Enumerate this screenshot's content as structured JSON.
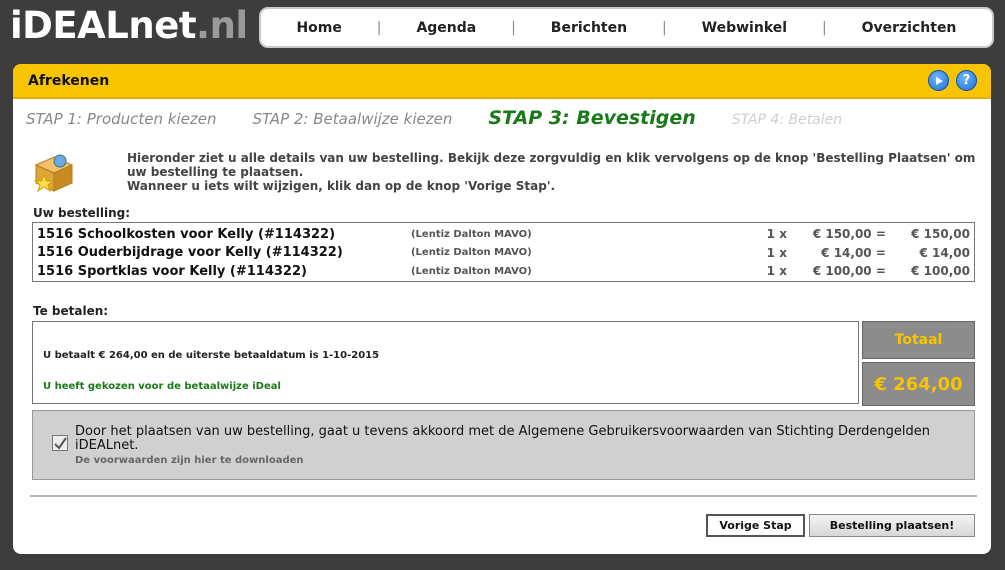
{
  "brand": {
    "name_main": "iDEALnet",
    "name_suffix": ".nl"
  },
  "nav": {
    "items": [
      "Home",
      "Agenda",
      "Berichten",
      "Webwinkel",
      "Overzichten"
    ],
    "separator": "|"
  },
  "panel": {
    "title": "Afrekenen",
    "next_icon": "play-icon",
    "help_icon": "help-icon"
  },
  "steps": [
    {
      "label": "STAP 1: Producten kiezen",
      "state": "done"
    },
    {
      "label": "STAP 2: Betaalwijze kiezen",
      "state": "done"
    },
    {
      "label": "STAP 3: Bevestigen",
      "state": "active"
    },
    {
      "label": "STAP 4: Betalen",
      "state": "future"
    }
  ],
  "intro": {
    "line1": "Hieronder ziet u alle details van uw bestelling. Bekijk deze zorgvuldig en klik vervolgens op de knop 'Bestelling Plaatsen' om uw bestelling te plaatsen.",
    "line2": "Wanneer u iets wilt wijzigen, klik dan op de knop 'Vorige Stap'."
  },
  "order": {
    "label": "Uw bestelling:",
    "rows": [
      {
        "name": "1516 Schoolkosten voor Kelly (#114322)",
        "school": "(Lentiz Dalton MAVO)",
        "qty": "1 x",
        "unit": "€ 150,00 =",
        "total": "€ 150,00"
      },
      {
        "name": "1516 Ouderbijdrage voor Kelly (#114322)",
        "school": "(Lentiz Dalton MAVO)",
        "qty": "1 x",
        "unit": "€ 14,00 =",
        "total": "€ 14,00"
      },
      {
        "name": "1516 Sportklas voor Kelly (#114322)",
        "school": "(Lentiz Dalton MAVO)",
        "qty": "1 x",
        "unit": "€ 100,00 =",
        "total": "€ 100,00"
      }
    ]
  },
  "payment": {
    "label": "Te betalen:",
    "due_text": "U betaalt € 264,00 en de uiterste betaaldatum is 1-10-2015",
    "method_text": "U heeft gekozen voor de betaalwijze iDeal",
    "total_label": "Totaal",
    "total_value": "€ 264,00"
  },
  "agreement": {
    "text": "Door het plaatsen van uw bestelling, gaat u tevens akkoord met de Algemene Gebruikersvoorwaarden van Stichting Derdengelden iDEALnet.",
    "download_text": "De voorwaarden zijn hier te downloaden",
    "checked": true
  },
  "buttons": {
    "prev": "Vorige Stap",
    "place": "Bestelling plaatsen!"
  },
  "colors": {
    "accent": "#f8c400",
    "active_step": "#1a7a1a",
    "total_box": "#8c8c8c"
  }
}
